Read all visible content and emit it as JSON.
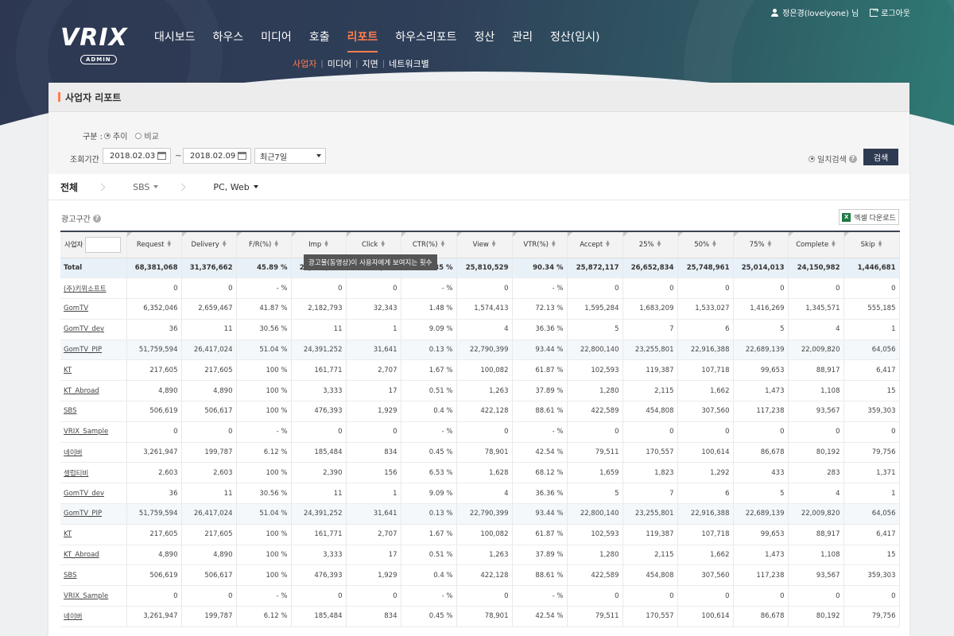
{
  "header": {
    "logo_text": "VRIX",
    "logo_sub": "ADMIN",
    "user_name": "정은경(lovelyone) 님",
    "logout_label": "로그아웃",
    "nav": [
      "대시보드",
      "하우스",
      "미디어",
      "호출",
      "리포트",
      "하우스리포트",
      "정산",
      "관리",
      "정산(임시)"
    ],
    "nav_active": "리포트",
    "subnav": [
      "사업자",
      "미디어",
      "지면",
      "네트워크별"
    ],
    "subnav_active": "사업자",
    "accent_color": "#ff7d4f"
  },
  "page": {
    "title": "사업자 리포트",
    "filters": {
      "type_label": "구분 :",
      "type_options": [
        "추이",
        "비교"
      ],
      "type_selected": "추이",
      "period_label": "조회기간 :",
      "date_from": "2018.02.03",
      "date_sep": "~",
      "date_to": "2018.02.09",
      "preset": "최근7일",
      "daily_search_label": "일치검색",
      "search_button": "검색"
    },
    "breadcrumb": [
      "전체",
      "SBS",
      "PC, Web"
    ],
    "section_label": "광고구간",
    "excel_button": "엑셀 다운로드",
    "tooltip": "광고물(동영상)이 사용자에게 보여지는 횟수"
  },
  "table": {
    "columns": [
      "사업자",
      "Request",
      "Delivery",
      "F/R(%)",
      "Imp",
      "Click",
      "CTR(%)",
      "View",
      "VTR(%)",
      "Accept",
      "25%",
      "50%",
      "75%",
      "Complete",
      "Skip"
    ],
    "total": [
      "Total",
      "68,381,068",
      "31,376,662",
      "45.89 %",
      "28,571,018",
      "99,545",
      "0.35 %",
      "25,810,529",
      "90.34 %",
      "25,872,117",
      "26,652,834",
      "25,748,961",
      "25,014,013",
      "24,150,982",
      "1,446,681"
    ],
    "rows": [
      [
        "(주)키위소프트",
        "0",
        "0",
        "- %",
        "0",
        "0",
        "- %",
        "0",
        "- %",
        "0",
        "0",
        "0",
        "0",
        "0",
        "0"
      ],
      [
        "GomTV",
        "6,352,046",
        "2,659,467",
        "41.87 %",
        "2,182,793",
        "32,343",
        "1.48 %",
        "1,574,413",
        "72.13 %",
        "1,595,284",
        "1,683,209",
        "1,533,027",
        "1,416,269",
        "1,345,571",
        "555,185"
      ],
      [
        "GomTV_dev",
        "36",
        "11",
        "30.56 %",
        "11",
        "1",
        "9.09 %",
        "4",
        "36.36 %",
        "5",
        "7",
        "6",
        "5",
        "4",
        "1"
      ],
      [
        "GomTV_PIP",
        "51,759,594",
        "26,417,024",
        "51.04 %",
        "24,391,252",
        "31,641",
        "0.13 %",
        "22,790,399",
        "93.44 %",
        "22,800,140",
        "23,255,801",
        "22,916,388",
        "22,689,139",
        "22,009,820",
        "64,056"
      ],
      [
        "KT",
        "217,605",
        "217,605",
        "100 %",
        "161,771",
        "2,707",
        "1.67 %",
        "100,082",
        "61.87 %",
        "102,593",
        "119,387",
        "107,718",
        "99,653",
        "88,917",
        "6,417"
      ],
      [
        "KT_Abroad",
        "4,890",
        "4,890",
        "100 %",
        "3,333",
        "17",
        "0.51 %",
        "1,263",
        "37.89 %",
        "1,280",
        "2,115",
        "1,662",
        "1,473",
        "1,108",
        "15"
      ],
      [
        "SBS",
        "506,619",
        "506,617",
        "100 %",
        "476,393",
        "1,929",
        "0.4 %",
        "422,128",
        "88.61 %",
        "422,589",
        "454,808",
        "307,560",
        "117,238",
        "93,567",
        "359,303"
      ],
      [
        "VRIX_Sample",
        "0",
        "0",
        "- %",
        "0",
        "0",
        "- %",
        "0",
        "- %",
        "0",
        "0",
        "0",
        "0",
        "0",
        "0"
      ],
      [
        "네이버",
        "3,261,947",
        "199,787",
        "6.12 %",
        "185,484",
        "834",
        "0.45 %",
        "78,901",
        "42.54 %",
        "79,511",
        "170,557",
        "100,614",
        "86,678",
        "80,192",
        "79,756"
      ],
      [
        "셀럽티비",
        "2,603",
        "2,603",
        "100 %",
        "2,390",
        "156",
        "6.53 %",
        "1,628",
        "68.12 %",
        "1,659",
        "1,823",
        "1,292",
        "433",
        "283",
        "1,371"
      ],
      [
        "GomTV_dev",
        "36",
        "11",
        "30.56 %",
        "11",
        "1",
        "9.09 %",
        "4",
        "36.36 %",
        "5",
        "7",
        "6",
        "5",
        "4",
        "1"
      ],
      [
        "GomTV_PIP",
        "51,759,594",
        "26,417,024",
        "51.04 %",
        "24,391,252",
        "31,641",
        "0.13 %",
        "22,790,399",
        "93.44 %",
        "22,800,140",
        "23,255,801",
        "22,916,388",
        "22,689,139",
        "22,009,820",
        "64,056"
      ],
      [
        "KT",
        "217,605",
        "217,605",
        "100 %",
        "161,771",
        "2,707",
        "1.67 %",
        "100,082",
        "61.87 %",
        "102,593",
        "119,387",
        "107,718",
        "99,653",
        "88,917",
        "6,417"
      ],
      [
        "KT_Abroad",
        "4,890",
        "4,890",
        "100 %",
        "3,333",
        "17",
        "0.51 %",
        "1,263",
        "37.89 %",
        "1,280",
        "2,115",
        "1,662",
        "1,473",
        "1,108",
        "15"
      ],
      [
        "SBS",
        "506,619",
        "506,617",
        "100 %",
        "476,393",
        "1,929",
        "0.4 %",
        "422,128",
        "88.61 %",
        "422,589",
        "454,808",
        "307,560",
        "117,238",
        "93,567",
        "359,303"
      ],
      [
        "VRIX_Sample",
        "0",
        "0",
        "- %",
        "0",
        "0",
        "- %",
        "0",
        "- %",
        "0",
        "0",
        "0",
        "0",
        "0",
        "0"
      ],
      [
        "네이버",
        "3,261,947",
        "199,787",
        "6.12 %",
        "185,484",
        "834",
        "0.45 %",
        "78,901",
        "42.54 %",
        "79,511",
        "170,557",
        "100,614",
        "86,678",
        "80,192",
        "79,756"
      ]
    ],
    "highlight_rows": [
      3,
      11
    ]
  }
}
